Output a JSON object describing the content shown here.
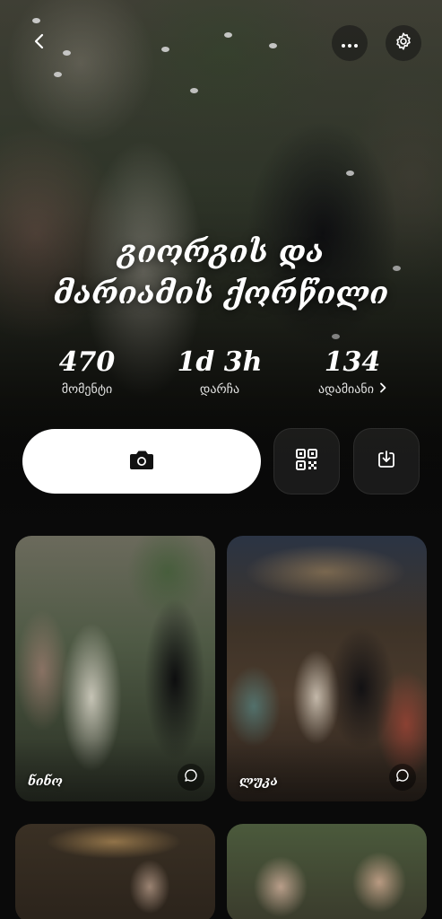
{
  "event": {
    "title_line1": "გიორგის და",
    "title_line2": "მარიამის ქორწილი"
  },
  "stats": [
    {
      "value": "470",
      "label": "მომენტი"
    },
    {
      "value": "1d 3h",
      "label": "დარჩა"
    },
    {
      "value": "134",
      "label": "ადამიანი"
    }
  ],
  "icons": {
    "back": "chevron-left-icon",
    "more": "more-horizontal-icon",
    "settings": "gear-icon",
    "upload": "camera-icon",
    "qr": "qr-code-icon",
    "download": "download-icon",
    "people_chevron": "chevron-right-icon",
    "comment": "comment-icon"
  },
  "feed": [
    {
      "author": "ნინო"
    },
    {
      "author": "ლუკა"
    },
    {
      "author": ""
    },
    {
      "author": ""
    }
  ]
}
